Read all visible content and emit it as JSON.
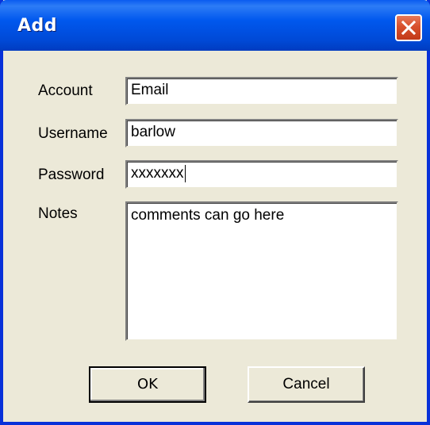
{
  "dialog": {
    "title": "Add",
    "close_icon": "close-icon"
  },
  "form": {
    "account_label": "Account",
    "account_value": "Email",
    "username_label": "Username",
    "username_value": "barlow",
    "password_label": "Password",
    "password_value": "xxxxxxx",
    "notes_label": "Notes",
    "notes_value": "comments can go here"
  },
  "buttons": {
    "ok_label": "OK",
    "cancel_label": "Cancel"
  },
  "colors": {
    "titlebar": "#0058ee",
    "close_button": "#d8502c",
    "dialog_background": "#ece9d8"
  }
}
